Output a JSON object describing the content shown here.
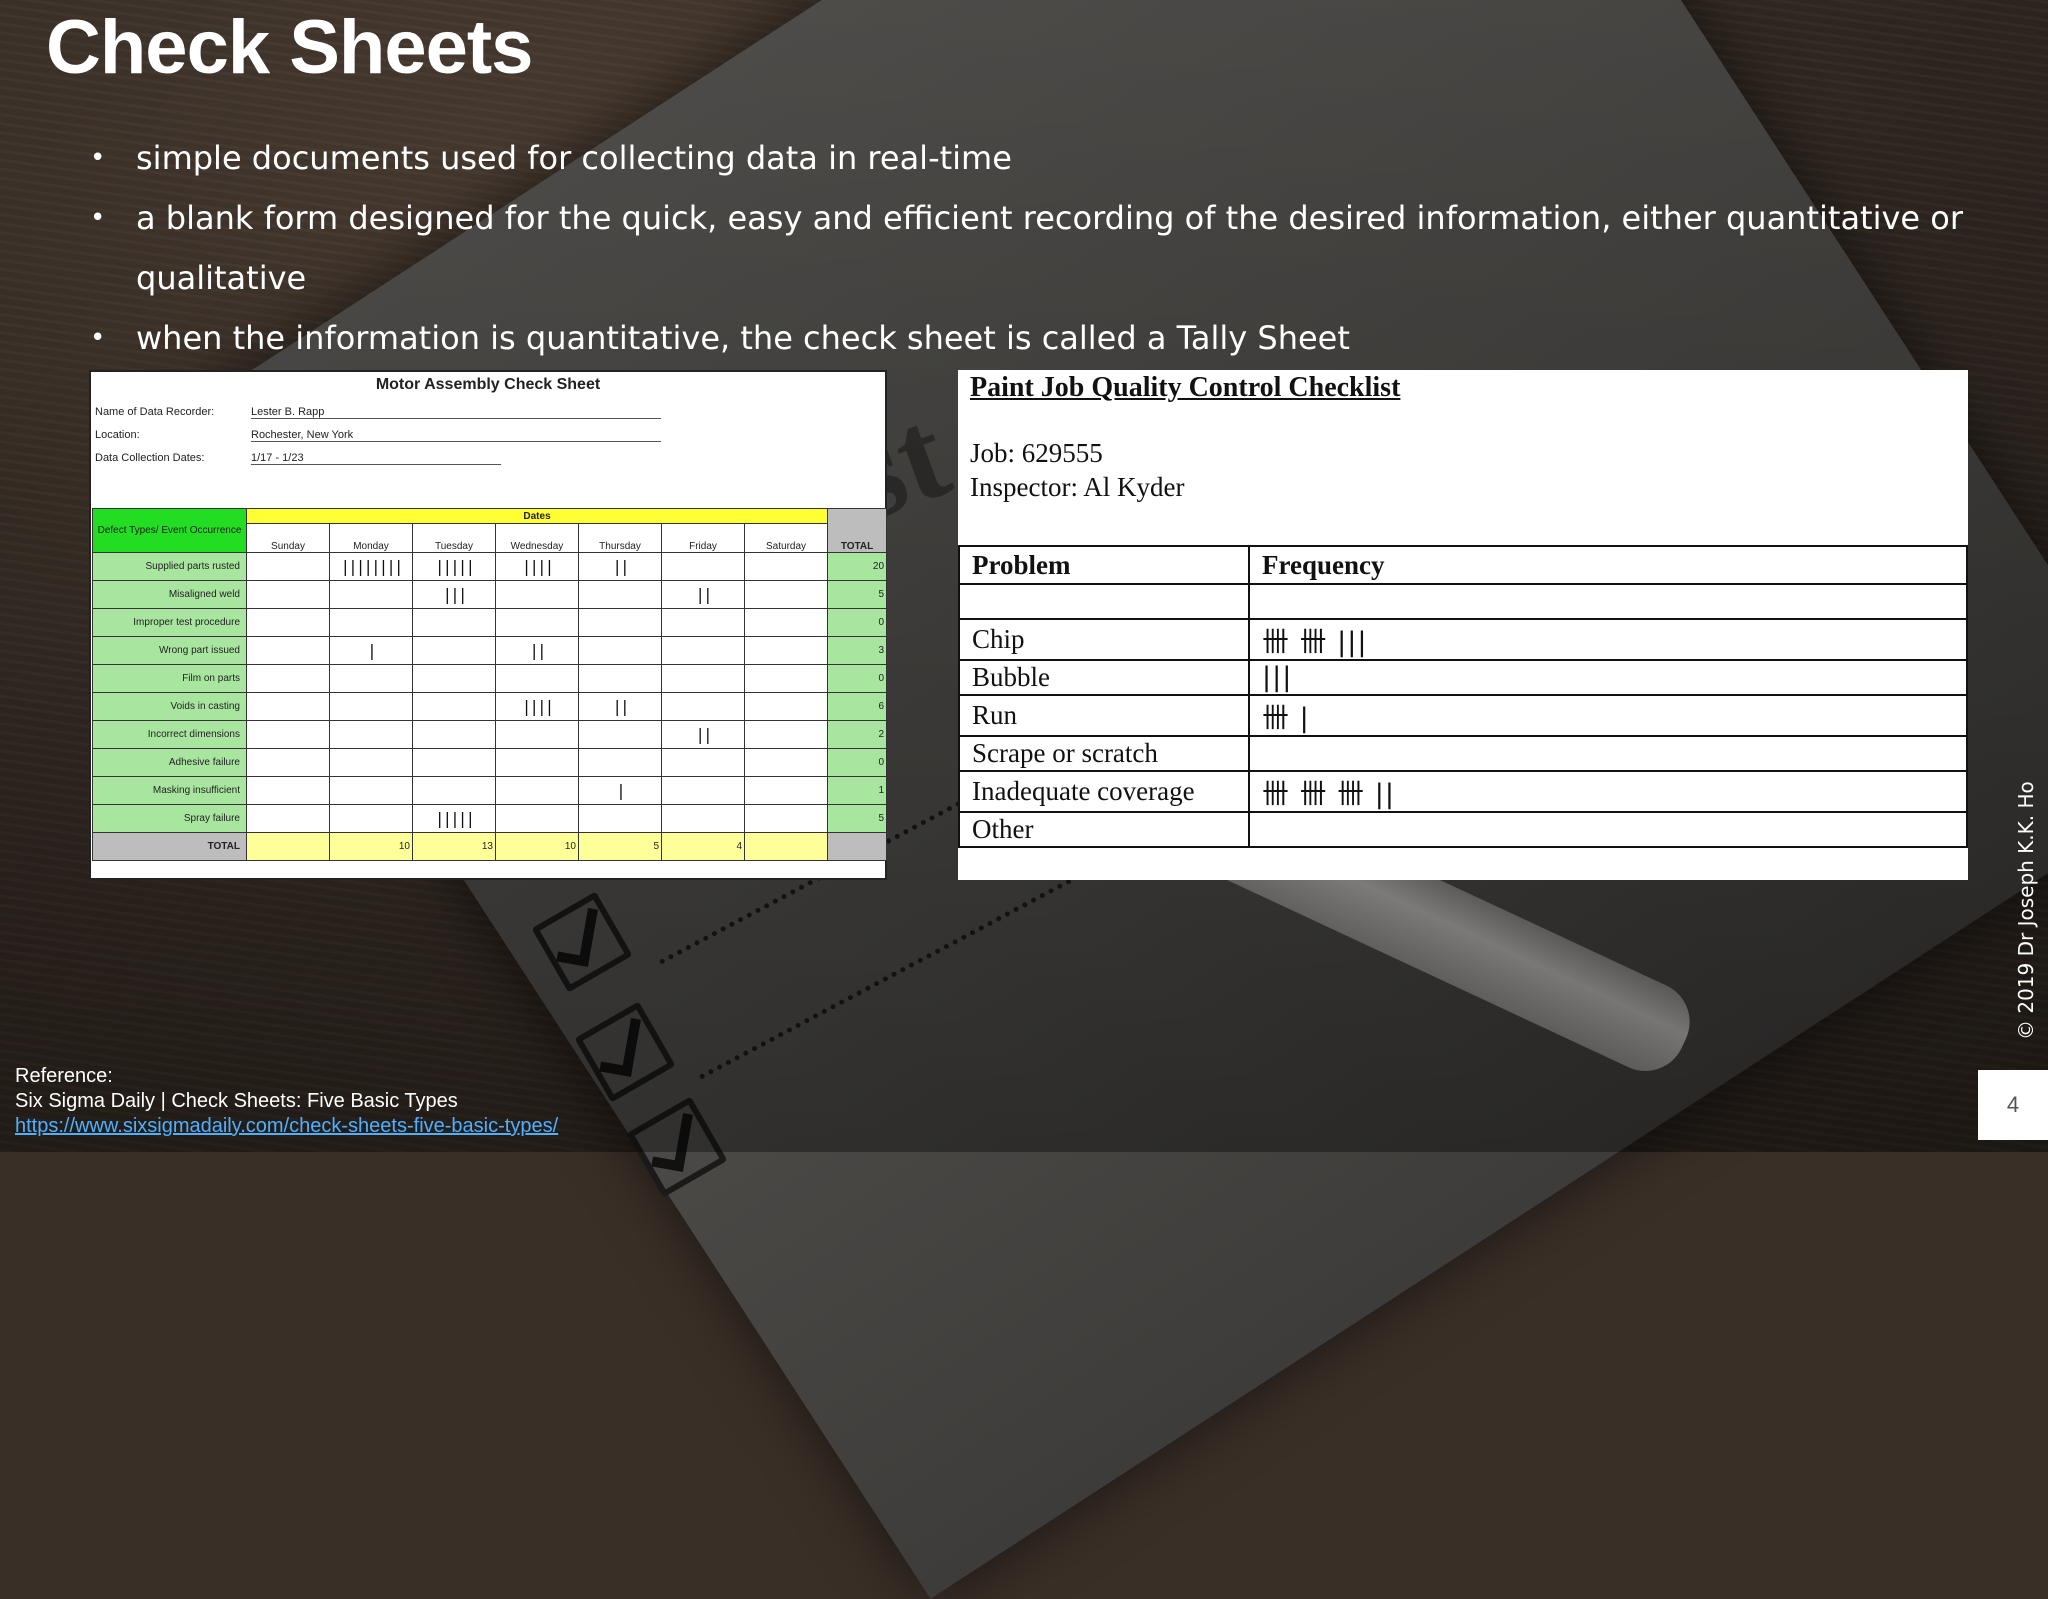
{
  "slide": {
    "title": "Check Sheets",
    "bullets": [
      "simple documents used for collecting data in real-time",
      "a blank form designed for the quick, easy and efficient recording of the desired information, either quantitative or qualitative",
      "when the information is quantitative, the check sheet is called a Tally Sheet"
    ],
    "copyright": "© 2019 Dr Joseph K.K. Ho",
    "page_number": "4",
    "reference": {
      "label": "Reference:",
      "source": "Six Sigma Daily | Check Sheets: Five Basic Types",
      "url": "https://www.sixsigmadaily.com/check-sheets-five-basic-types/"
    }
  },
  "motor_sheet": {
    "title": "Motor Assembly Check Sheet",
    "recorder_label": "Name of Data Recorder:",
    "recorder_value": "Lester B. Rapp",
    "location_label": "Location:",
    "location_value": "Rochester, New York",
    "dates_label": "Data Collection Dates:",
    "dates_value": "1/17 - 1/23",
    "defect_header": "Defect Types/ Event Occurrence",
    "dates_header": "Dates",
    "days": [
      "Sunday",
      "Monday",
      "Tuesday",
      "Wednesday",
      "Thursday",
      "Friday",
      "Saturday"
    ],
    "total_header": "TOTAL",
    "rows": [
      {
        "label": "Supplied parts rusted",
        "tallies": [
          "",
          "||||||||",
          "|||||",
          "||||",
          "||",
          "",
          ""
        ],
        "total": "20"
      },
      {
        "label": "Misaligned weld",
        "tallies": [
          "",
          "",
          "|||",
          "",
          "",
          "||",
          ""
        ],
        "total": "5"
      },
      {
        "label": "Improper test procedure",
        "tallies": [
          "",
          "",
          "",
          "",
          "",
          "",
          ""
        ],
        "total": "0"
      },
      {
        "label": "Wrong part issued",
        "tallies": [
          "",
          "|",
          "",
          "||",
          "",
          "",
          ""
        ],
        "total": "3"
      },
      {
        "label": "Film on parts",
        "tallies": [
          "",
          "",
          "",
          "",
          "",
          "",
          ""
        ],
        "total": "0"
      },
      {
        "label": "Voids in casting",
        "tallies": [
          "",
          "",
          "",
          "||||",
          "||",
          "",
          ""
        ],
        "total": "6"
      },
      {
        "label": "Incorrect dimensions",
        "tallies": [
          "",
          "",
          "",
          "",
          "",
          "||",
          ""
        ],
        "total": "2"
      },
      {
        "label": "Adhesive failure",
        "tallies": [
          "",
          "",
          "",
          "",
          "",
          "",
          ""
        ],
        "total": "0"
      },
      {
        "label": "Masking insufficient",
        "tallies": [
          "",
          "",
          "",
          "",
          "|",
          "",
          ""
        ],
        "total": "1"
      },
      {
        "label": "Spray failure",
        "tallies": [
          "",
          "",
          "|||||",
          "",
          "",
          "",
          ""
        ],
        "total": "5"
      }
    ],
    "total_row_label": "TOTAL",
    "day_totals": [
      "",
      "10",
      "13",
      "10",
      "5",
      "4",
      ""
    ]
  },
  "paint_sheet": {
    "title": "Paint Job Quality Control Checklist",
    "job": "Job: 629555",
    "inspector": "Inspector: Al Kyder",
    "col_problem": "Problem",
    "col_frequency": "Frequency",
    "rows": [
      {
        "problem": "Chip",
        "frequency": "卌 卌 |||"
      },
      {
        "problem": "Bubble",
        "frequency": "|||"
      },
      {
        "problem": "Run",
        "frequency": "卌 |"
      },
      {
        "problem": "Scrape or scratch",
        "frequency": ""
      },
      {
        "problem": "Inadequate coverage",
        "frequency": "卌 卌 卌 ||"
      },
      {
        "problem": "Other",
        "frequency": ""
      }
    ]
  }
}
